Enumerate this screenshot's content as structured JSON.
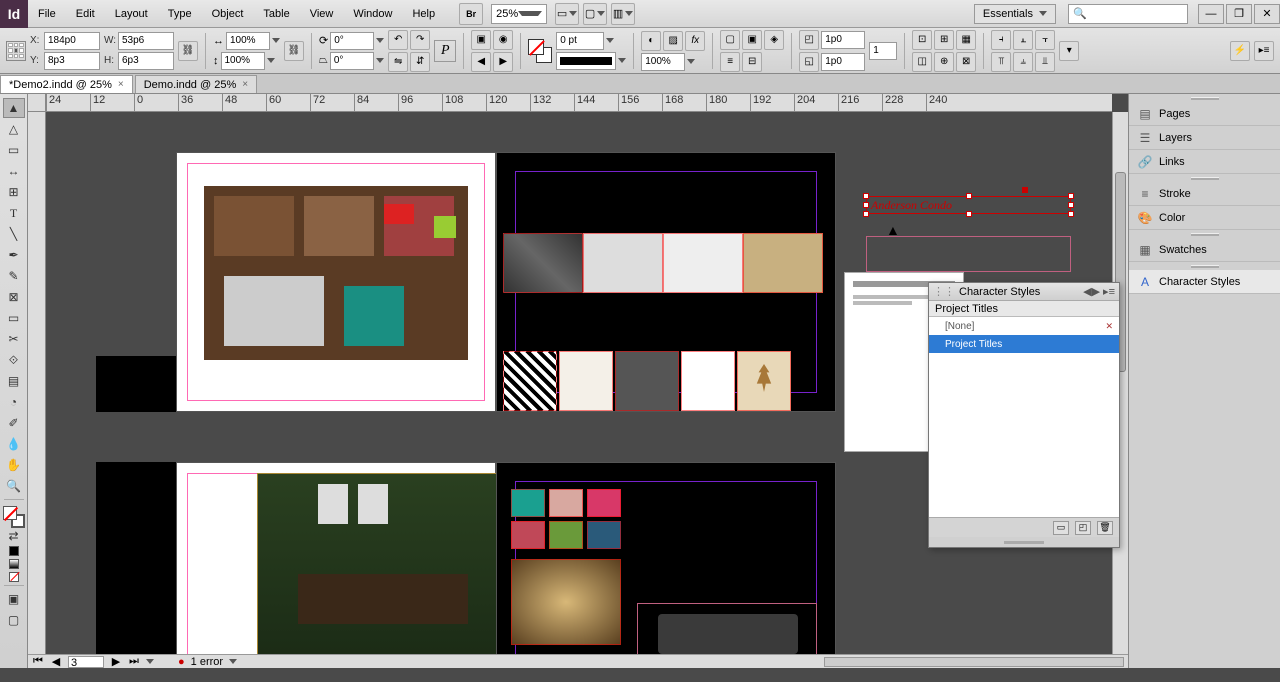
{
  "menu": {
    "items": [
      "File",
      "Edit",
      "Layout",
      "Type",
      "Object",
      "Table",
      "View",
      "Window",
      "Help"
    ]
  },
  "zoom": "25%",
  "workspace": "Essentials",
  "search_placeholder": "",
  "control": {
    "x": "184p0",
    "y": "8p3",
    "w": "53p6",
    "h": "6p3",
    "scale_x": "100%",
    "scale_y": "100%",
    "rotate": "0°",
    "shear": "0°",
    "stroke_pt": "0 pt",
    "opacity": "100%",
    "num_a": "1p0",
    "num_b": "1p0",
    "num_c": "1"
  },
  "tabs": [
    {
      "label": "*Demo2.indd @ 25%",
      "active": true
    },
    {
      "label": "Demo.indd @ 25%",
      "active": false
    }
  ],
  "ruler_marks": [
    "24",
    "12",
    "0",
    "36",
    "48",
    "60",
    "72",
    "84",
    "96",
    "108",
    "120",
    "132",
    "144",
    "156",
    "168",
    "180",
    "192",
    "204",
    "216",
    "228",
    "240"
  ],
  "status": {
    "page": "3",
    "errors": "1 error"
  },
  "right_panels": {
    "group1": [
      "Pages",
      "Layers",
      "Links"
    ],
    "group2": [
      "Stroke",
      "Color"
    ],
    "group3": [
      "Swatches"
    ],
    "group4": [
      "Character Styles"
    ]
  },
  "char_styles_panel": {
    "title": "Character Styles",
    "subtitle": "Project Titles",
    "items": [
      "[None]",
      "Project Titles"
    ],
    "selected": 1
  },
  "selected_text": "Anderson Condo",
  "chart_data": null
}
